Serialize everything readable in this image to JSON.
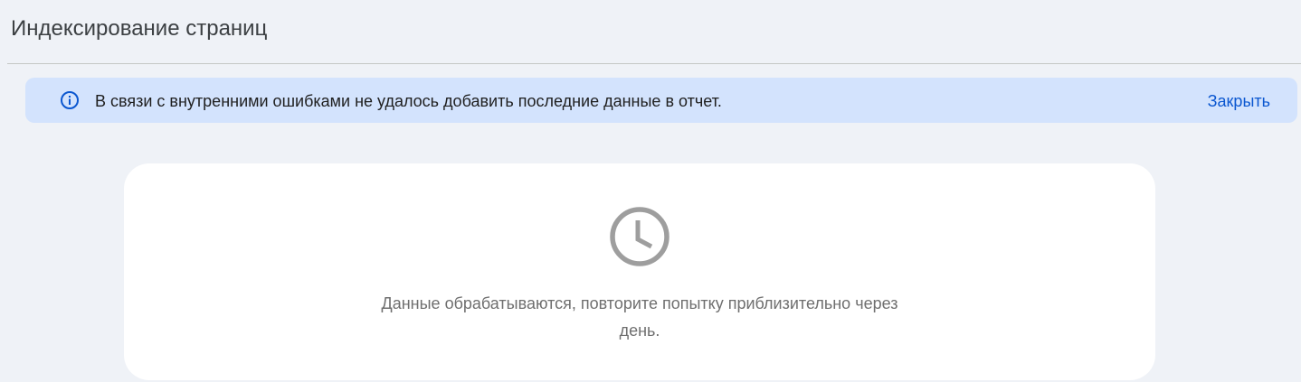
{
  "header": {
    "title": "Индексирование страниц"
  },
  "banner": {
    "icon": "info-icon",
    "message": "В связи с внутренними ошибками не удалось добавить последние данные в отчет.",
    "close_label": "Закрыть",
    "accent_color": "#0b57d0",
    "background_color": "#d3e3fd"
  },
  "status_card": {
    "icon": "clock-icon",
    "message_line_1": "Данные обрабатываются, повторите попытку приблизительно через",
    "message_line_2": "день."
  }
}
